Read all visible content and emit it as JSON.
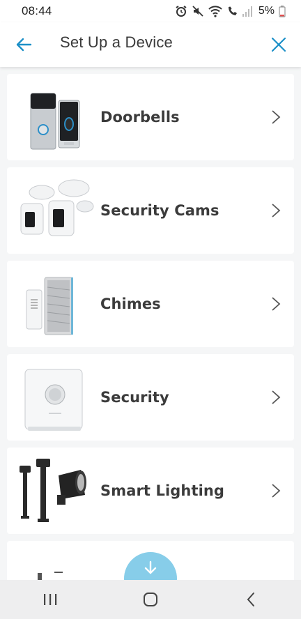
{
  "status_bar": {
    "time": "08:44",
    "battery_percent": "5%",
    "icons": [
      "alarm-icon",
      "mute-icon",
      "wifi-icon",
      "wifi-calling-icon",
      "signal-icon",
      "battery-icon"
    ]
  },
  "header": {
    "title": "Set Up a Device",
    "back_icon": "arrow-left-icon",
    "close_icon": "close-icon"
  },
  "devices": [
    {
      "label": "Doorbells",
      "icon": "doorbell-product-image"
    },
    {
      "label": "Security Cams",
      "icon": "security-cam-product-image"
    },
    {
      "label": "Chimes",
      "icon": "chime-product-image"
    },
    {
      "label": "Security",
      "icon": "alarm-base-product-image"
    },
    {
      "label": "Smart Lighting",
      "icon": "smart-lighting-product-image"
    }
  ],
  "fab": {
    "icon": "arrow-down-icon"
  },
  "nav_bar": {
    "icons": [
      "recents-icon",
      "home-icon",
      "back-icon"
    ]
  },
  "colors": {
    "accent": "#1b8fc7",
    "fab": "#87cde9",
    "background": "#f5f6f7",
    "card": "#ffffff",
    "text": "#3b3b3b"
  }
}
